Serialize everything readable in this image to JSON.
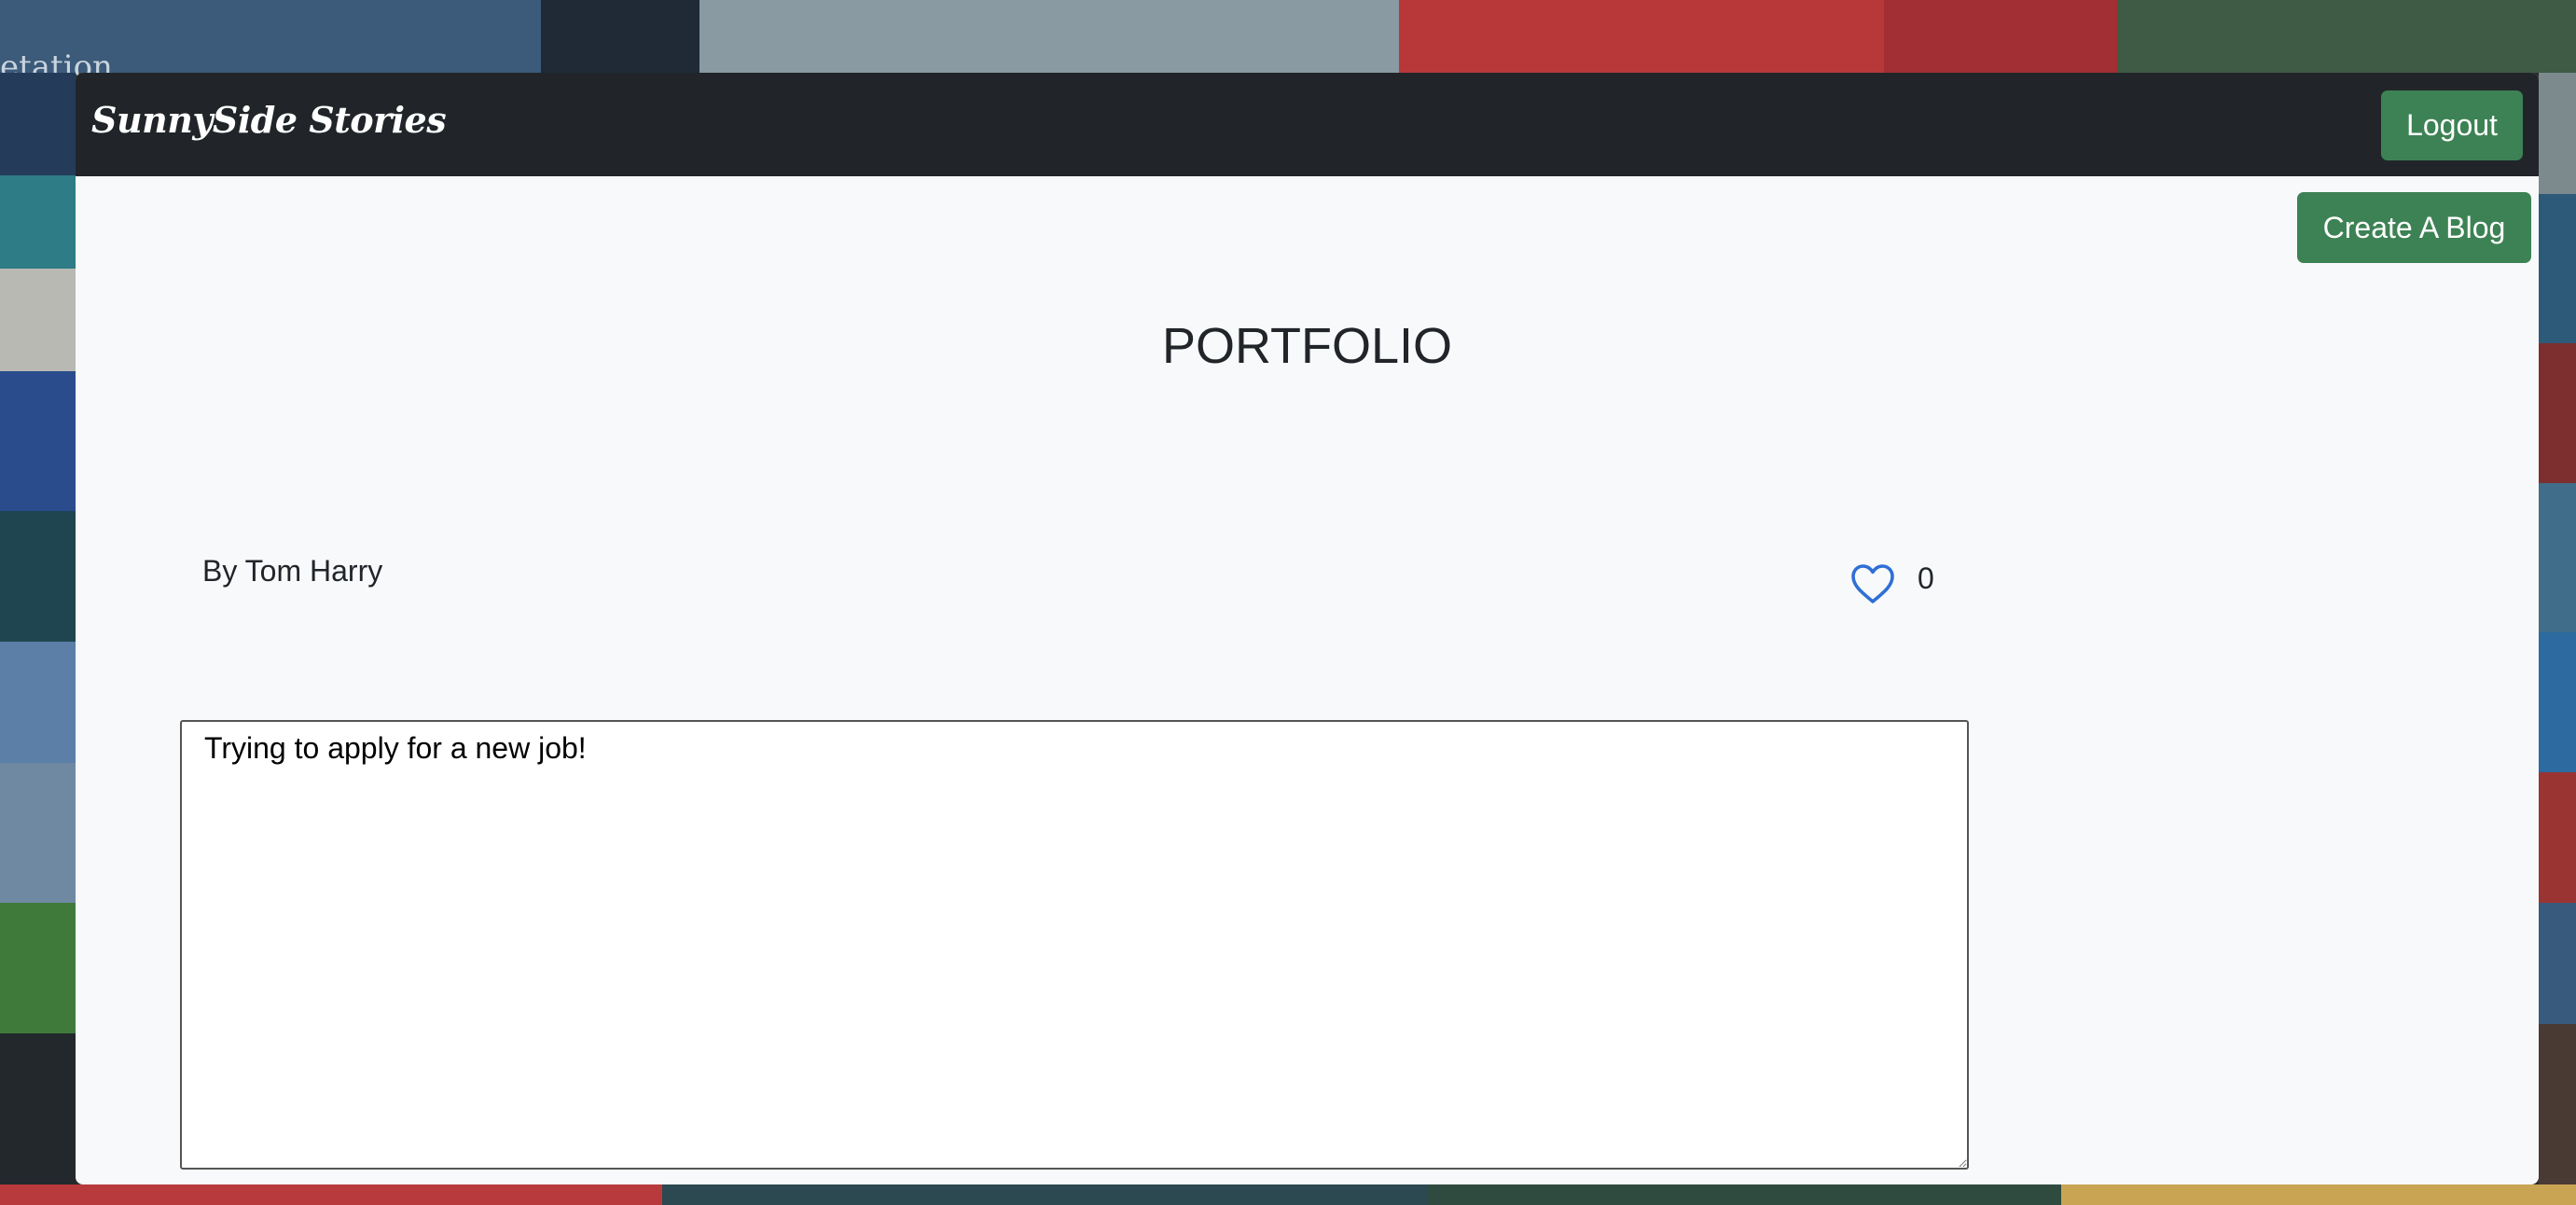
{
  "background": {
    "corner_text": "etation"
  },
  "navbar": {
    "brand": "SunnySide Stories",
    "logout_label": "Logout"
  },
  "actions": {
    "create_blog_label": "Create A Blog"
  },
  "post": {
    "title": "PORTFOLIO",
    "author_line": "By Tom Harry",
    "like_icon": "heart-outline-icon",
    "like_count": "0",
    "body": "Trying to apply for a new job!"
  },
  "colors": {
    "navbar_bg": "#212529",
    "page_bg": "#f8f9fa",
    "button_green": "#3d8254",
    "heart_blue": "#2f6fd6"
  }
}
